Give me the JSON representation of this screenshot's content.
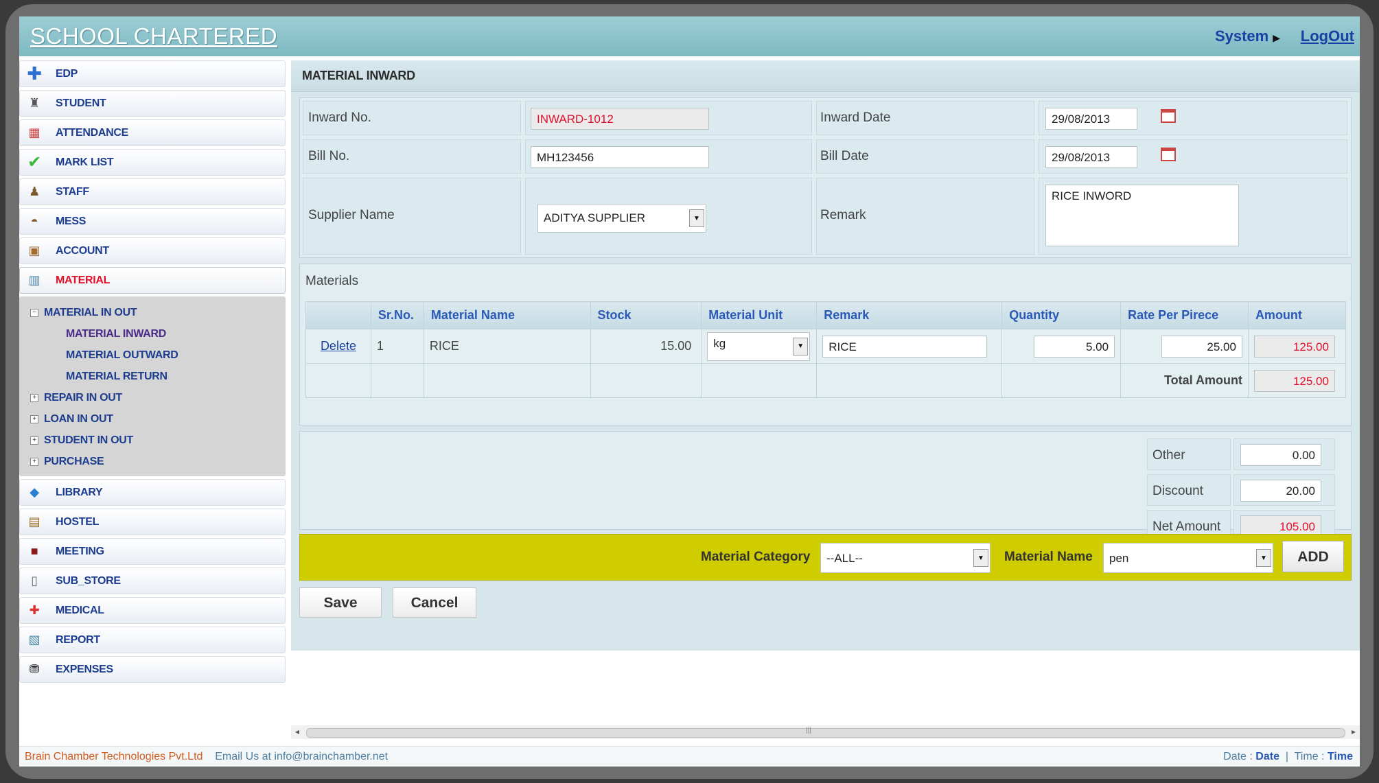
{
  "header": {
    "brand": "SCHOOL CHARTERED",
    "system_menu": "System",
    "logout": "LogOut"
  },
  "sidebar": {
    "items": [
      {
        "label": "EDP",
        "icon": "plus-icon"
      },
      {
        "label": "STUDENT",
        "icon": "student-icon"
      },
      {
        "label": "ATTENDANCE",
        "icon": "calendar-icon"
      },
      {
        "label": "MARK LIST",
        "icon": "checkmark-icon"
      },
      {
        "label": "STAFF",
        "icon": "staff-icon"
      },
      {
        "label": "MESS",
        "icon": "mess-icon"
      },
      {
        "label": "ACCOUNT",
        "icon": "account-icon"
      },
      {
        "label": "MATERIAL",
        "icon": "material-icon"
      },
      {
        "label": "LIBRARY",
        "icon": "library-icon"
      },
      {
        "label": "HOSTEL",
        "icon": "hostel-icon"
      },
      {
        "label": "MEETING",
        "icon": "meeting-icon"
      },
      {
        "label": "SUB_STORE",
        "icon": "store-icon"
      },
      {
        "label": "MEDICAL",
        "icon": "medical-icon"
      },
      {
        "label": "REPORT",
        "icon": "report-icon"
      },
      {
        "label": "EXPENSES",
        "icon": "expenses-icon"
      }
    ],
    "material_submenu": {
      "group": "MATERIAL IN OUT",
      "leaves": [
        "MATERIAL INWARD",
        "MATERIAL OUTWARD",
        "MATERIAL RETURN"
      ],
      "collapsed": [
        "REPAIR IN OUT",
        "LOAN IN OUT",
        "STUDENT IN OUT",
        "PURCHASE"
      ]
    }
  },
  "form": {
    "title": "MATERIAL INWARD",
    "inward_no_label": "Inward No.",
    "inward_no": "INWARD-1012",
    "inward_date_label": "Inward Date",
    "inward_date": "29/08/2013",
    "bill_no_label": "Bill No.",
    "bill_no": "MH123456",
    "bill_date_label": "Bill Date",
    "bill_date": "29/08/2013",
    "supplier_label": "Supplier Name",
    "supplier": "ADITYA SUPPLIER",
    "remark_label": "Remark",
    "remark": "RICE INWORD"
  },
  "materials": {
    "title": "Materials",
    "headers": [
      "",
      "Sr.No.",
      "Material Name",
      "Stock",
      "Material Unit",
      "Remark",
      "Quantity",
      "Rate Per Pirece",
      "Amount"
    ],
    "rows": [
      {
        "action": "Delete",
        "sr": "1",
        "name": "RICE",
        "stock": "15.00",
        "unit": "kg",
        "remark": "RICE",
        "quantity": "5.00",
        "rate": "25.00",
        "amount": "125.00"
      }
    ],
    "total_label": "Total Amount",
    "total": "125.00"
  },
  "summary": {
    "other_label": "Other",
    "other": "0.00",
    "discount_label": "Discount",
    "discount": "20.00",
    "net_label": "Net Amount",
    "net": "105.00"
  },
  "add_strip": {
    "category_label": "Material Category",
    "category": "--ALL--",
    "name_label": "Material Name",
    "name": "pen",
    "add": "ADD"
  },
  "actions": {
    "save": "Save",
    "cancel": "Cancel"
  },
  "footer": {
    "company": "Brain Chamber Technologies Pvt.Ltd",
    "email": "Email Us at info@brainchamber.net",
    "date_label": "Date :",
    "date": "Date",
    "time_label": "Time :",
    "time": "Time"
  },
  "colors": {
    "header": "#7fb9c2",
    "accent_yellow": "#cfcc00",
    "link_blue": "#1a3fa3",
    "active_red": "#e0102b"
  }
}
